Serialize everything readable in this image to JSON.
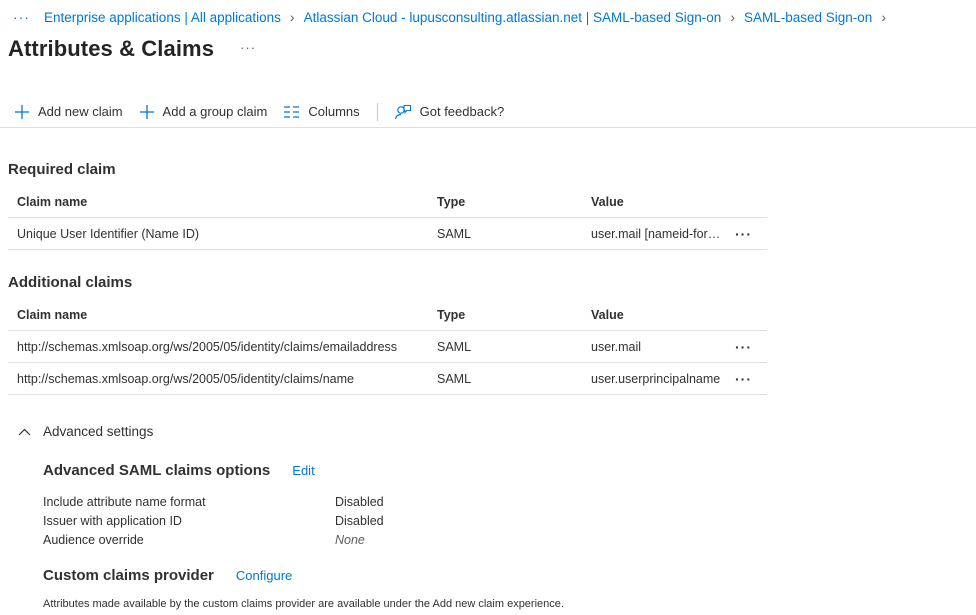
{
  "breadcrumb": {
    "items": [
      "Enterprise applications | All applications",
      "Atlassian Cloud - lupusconsulting.atlassian.net | SAML-based Sign-on",
      "SAML-based Sign-on"
    ]
  },
  "page": {
    "title": "Attributes & Claims"
  },
  "toolbar": {
    "add_claim": "Add new claim",
    "add_group_claim": "Add a group claim",
    "columns": "Columns",
    "feedback": "Got feedback?"
  },
  "required": {
    "title": "Required claim",
    "headers": {
      "name": "Claim name",
      "type": "Type",
      "value": "Value"
    },
    "rows": [
      {
        "name": "Unique User Identifier (Name ID)",
        "type": "SAML",
        "value": "user.mail [nameid-format:emailAddress]"
      }
    ]
  },
  "additional": {
    "title": "Additional claims",
    "headers": {
      "name": "Claim name",
      "type": "Type",
      "value": "Value"
    },
    "rows": [
      {
        "name": "http://schemas.xmlsoap.org/ws/2005/05/identity/claims/emailaddress",
        "type": "SAML",
        "value": "user.mail"
      },
      {
        "name": "http://schemas.xmlsoap.org/ws/2005/05/identity/claims/name",
        "type": "SAML",
        "value": "user.userprincipalname"
      }
    ]
  },
  "advanced": {
    "toggle_label": "Advanced settings",
    "saml_options": {
      "title": "Advanced SAML claims options",
      "edit_label": "Edit",
      "items": [
        {
          "label": "Include attribute name format",
          "value": "Disabled"
        },
        {
          "label": "Issuer with application ID",
          "value": "Disabled"
        },
        {
          "label": "Audience override",
          "value": "None"
        }
      ]
    },
    "custom_provider": {
      "title": "Custom claims provider",
      "configure_label": "Configure",
      "note": "Attributes made available by the custom claims provider are available under the Add new claim experience."
    }
  },
  "colors": {
    "accent": "#0078d4",
    "text": "#323130",
    "divider": "#e1dfdd"
  },
  "icons": {
    "breadcrumb_more": "more-horizontal-icon",
    "title_more": "more-horizontal-icon",
    "add": "plus-icon",
    "columns": "columns-icon",
    "feedback": "feedback-person-icon",
    "row_more": "more-horizontal-icon",
    "advanced_toggle": "chevron-up-icon"
  }
}
